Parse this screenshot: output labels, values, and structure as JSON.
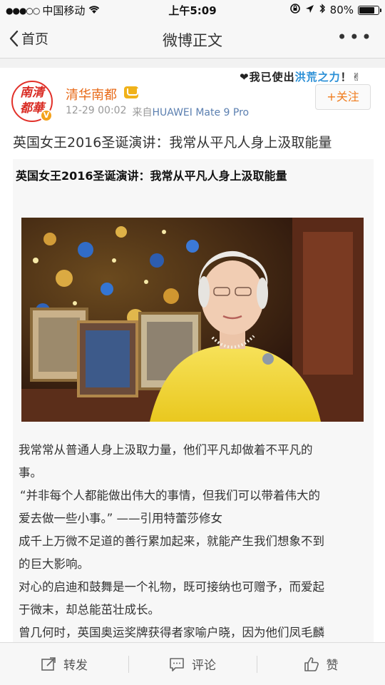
{
  "status_bar": {
    "carrier": "中国移动",
    "time": "上午5:09",
    "battery": "80%",
    "battery_level": 0.8
  },
  "nav": {
    "back_label": "首页",
    "title": "微博正文",
    "more_label": "•••"
  },
  "post": {
    "author": "清华南都",
    "avatar_text": "南清\n都華",
    "slogan_prefix": "❤我已使出",
    "slogan_highlight": "洪荒之力",
    "slogan_suffix": "！✌",
    "timestamp": "12-29 00:02",
    "source_prefix": "来自",
    "source": "HUAWEI Mate 9 Pro",
    "follow_label": "+关注",
    "headline": "英国女王2016圣诞演讲：我常从平凡人身上汲取能量"
  },
  "article": {
    "title": "英国女王2016圣诞演讲：我常从平凡人身上汲取能量",
    "paragraphs": [
      "我常常从普通人身上汲取力量，他们平凡却做着不平凡的",
      "事。",
      " “并非每个人都能做出伟大的事情，但我们可以带着伟大的",
      "爱去做一些小事。”   ——引用特蕾莎修女",
      "成千上万微不足道的善行累加起来，就能产生我们想象不到",
      "的巨大影响。",
      "对心的启迪和鼓舞是一个礼物，既可接纳也可赠予，而爱起",
      "于微末，却总能茁壮成长。",
      "曾几何时，英国奥运奖牌获得者家喻户晓，因为他们凤毛麟"
    ]
  },
  "tabbar": {
    "repost_label": "转发",
    "comment_label": "评论",
    "like_label": "赞"
  },
  "colors": {
    "accent_orange": "#e86b1a",
    "follow_orange": "#f07c1e",
    "brand_red": "#d92a22"
  }
}
